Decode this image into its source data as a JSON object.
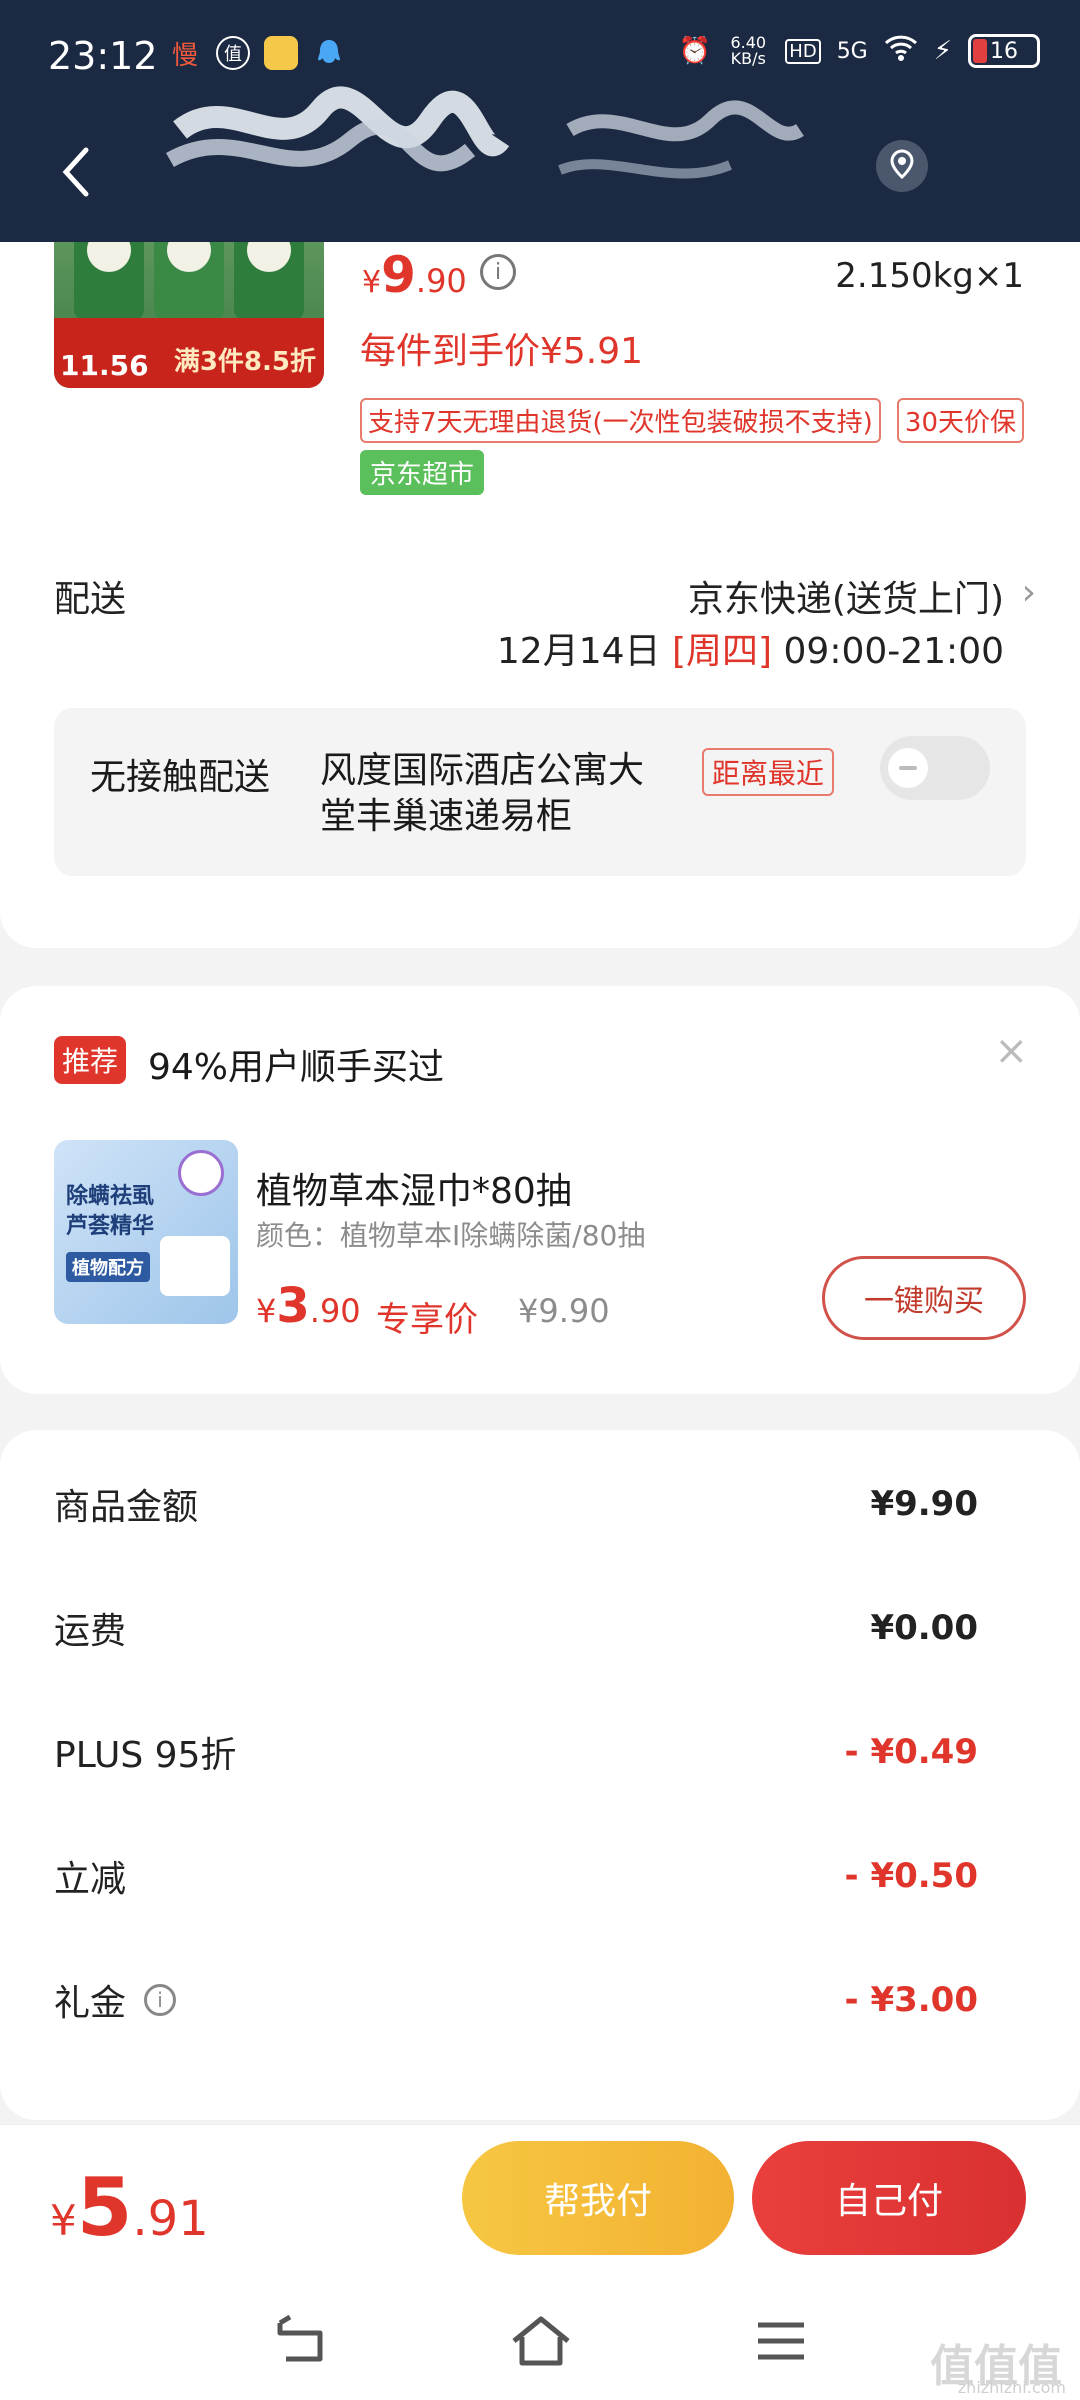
{
  "status_bar": {
    "time": "23:12",
    "notif_badge": "慢",
    "notif_icon2": "值",
    "net_speed": "6.40 KB/s",
    "hd": "HD",
    "signal": "5G",
    "battery": "16"
  },
  "product": {
    "image_price_tag": "11.56",
    "image_promo": "满3件8.5折",
    "price_symbol": "¥",
    "price_big": "9",
    "price_small": ".90",
    "weight_qty": "2.150kg×1",
    "unit_price": "每件到手价¥5.91",
    "tag_return": "支持7天无理由退货(一次性包装破损不支持)",
    "tag_price_protect": "30天价保",
    "store_tag": "京东超市"
  },
  "delivery": {
    "label": "配送",
    "method": "京东快递(送货上门)",
    "date": "12月14日",
    "weekday": "[周四]",
    "time_range": "09:00-21:00"
  },
  "no_contact": {
    "label": "无接触配送",
    "address": "风度国际酒店公寓大堂丰巢速递易柜",
    "distance_tag": "距离最近",
    "enabled": false
  },
  "recommend": {
    "badge": "推荐",
    "headline": "94%用户顺手买过",
    "close": "×",
    "image_lines": [
      "除螨祛虱",
      "芦荟精华",
      "植物配方"
    ],
    "item_name": "植物草本湿巾*80抽",
    "item_spec": "颜色：植物草本I除螨除菌/80抽",
    "price_symbol": "¥",
    "price_big": "3",
    "price_small": ".90",
    "exclusive": "专享价",
    "original_price": "¥9.90",
    "buy_button": "一键购买"
  },
  "summary": [
    {
      "label": "商品金额",
      "value": "¥9.90",
      "negative": false,
      "info": false
    },
    {
      "label": "运费",
      "value": "¥0.00",
      "negative": false,
      "info": false
    },
    {
      "label": "PLUS 95折",
      "value": "- ¥0.49",
      "negative": true,
      "info": false
    },
    {
      "label": "立减",
      "value": "- ¥0.50",
      "negative": true,
      "info": false
    },
    {
      "label": "礼金",
      "value": "- ¥3.00",
      "negative": true,
      "info": true
    }
  ],
  "bottom": {
    "total_symbol": "¥",
    "total_big": "5",
    "total_small": ".91",
    "help_pay": "帮我付",
    "self_pay": "自己付"
  },
  "watermark": {
    "text": "值值值",
    "sub": "zhizhizhi.com"
  },
  "colors": {
    "header": "#1b2a42",
    "accent": "#e0352b",
    "green": "#5bbf5b",
    "yellow": "#f6c742"
  }
}
